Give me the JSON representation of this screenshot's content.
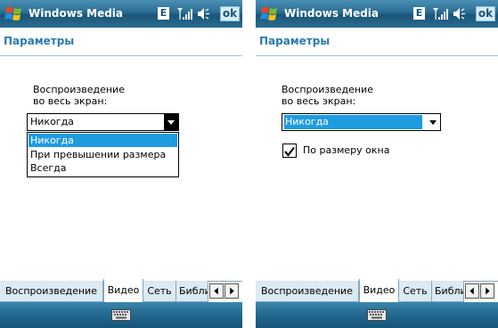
{
  "screens": [
    {
      "id": "left",
      "title": "Windows Media",
      "status_indicator": "E",
      "ok_label": "ok",
      "heading": "Параметры",
      "fullscreen_label_line1": "Воспроизведение",
      "fullscreen_label_line2": "во весь экран:",
      "combo_value": "Никогда",
      "combo_options": [
        "Никогда",
        "При превышении размера",
        "Всегда"
      ],
      "tabs": [
        "Воспроизведение",
        "Видео",
        "Сеть",
        "Библи"
      ]
    },
    {
      "id": "right",
      "title": "Windows Media",
      "status_indicator": "E",
      "ok_label": "ok",
      "heading": "Параметры",
      "fullscreen_label_line1": "Воспроизведение",
      "fullscreen_label_line2": "во весь экран:",
      "combo_value": "Никогда",
      "checkbox_label": "По размеру окна",
      "checkbox_checked": true,
      "tabs": [
        "Воспроизведение",
        "Видео",
        "Сеть",
        "Библи"
      ]
    }
  ],
  "icons": {
    "start": "windows-flag-icon",
    "signal": "signal-icon",
    "volume": "volume-icon",
    "keyboard": "keyboard-icon",
    "dropdown": "dropdown-arrow-icon",
    "tab_prev": "arrow-left-icon",
    "tab_next": "arrow-right-icon"
  },
  "colors": {
    "titlebar": "#2a6d92",
    "heading": "#2a7cb0",
    "selection": "#1f9be0",
    "tab_inactive": "#dbeaf3"
  }
}
